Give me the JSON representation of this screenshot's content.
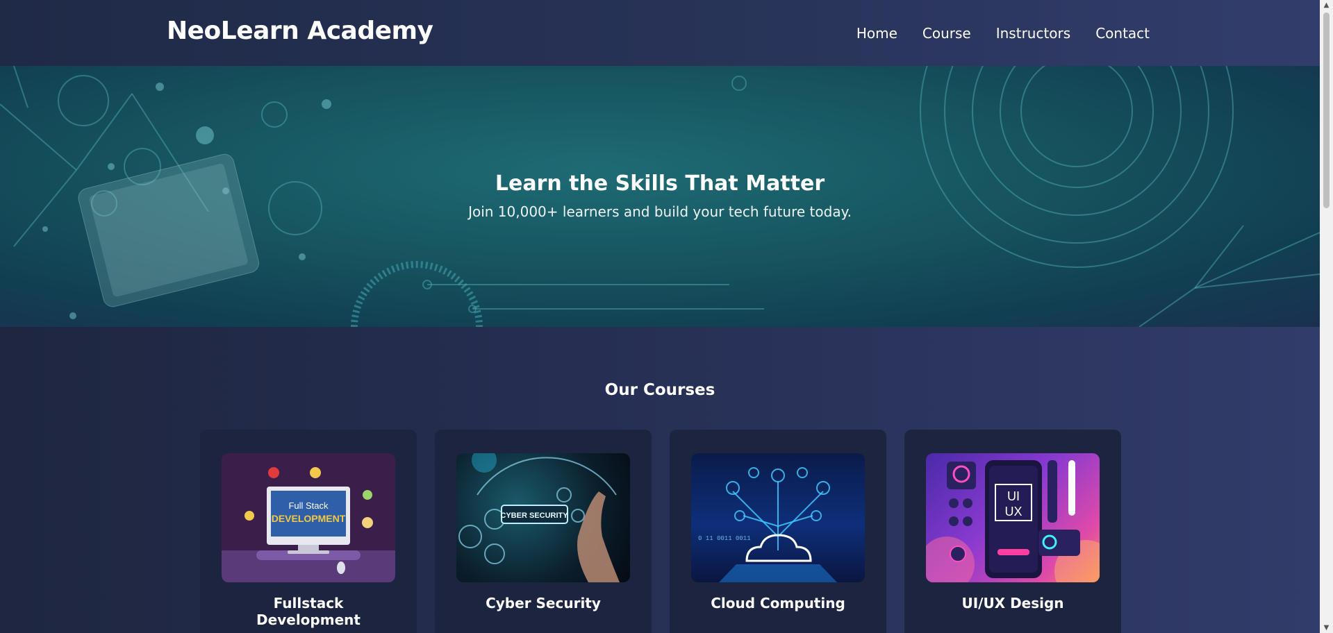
{
  "header": {
    "brand": "NeoLearn Academy",
    "nav": [
      "Home",
      "Course",
      "Instructors",
      "Contact"
    ]
  },
  "hero": {
    "title": "Learn the Skills That Matter",
    "subtitle": "Join 10,000+ learners and build your tech future today."
  },
  "courses": {
    "title": "Our Courses",
    "items": [
      {
        "name": "Fullstack Development",
        "thumb_label_1": "Full Stack",
        "thumb_label_2": "DEVELOPMENT"
      },
      {
        "name": "Cyber Security",
        "thumb_label_1": "CYBER SECURITY"
      },
      {
        "name": "Cloud Computing",
        "thumb_label_1": "0 11 0011 0011"
      },
      {
        "name": "UI/UX Design",
        "thumb_label_1": "UI",
        "thumb_label_2": "UX"
      }
    ]
  },
  "colors": {
    "background": "#283157",
    "header": "#273256",
    "hero": "#16535e",
    "card": "#1c2440"
  }
}
